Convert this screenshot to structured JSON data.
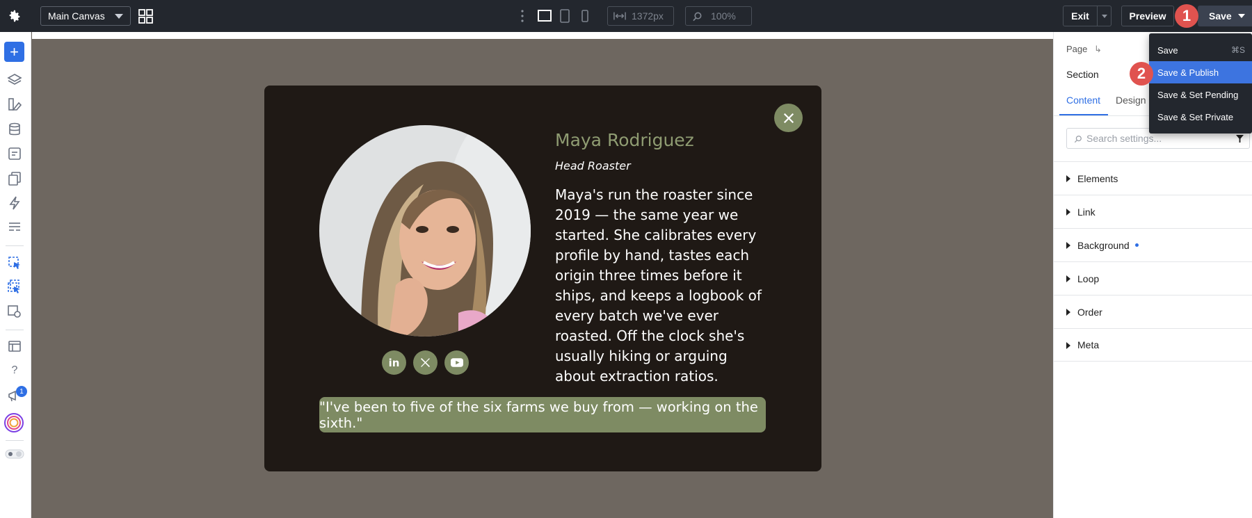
{
  "toolbar": {
    "canvas_select": "Main Canvas",
    "width_value": "1372px",
    "zoom_value": "100%",
    "exit_label": "Exit",
    "preview_label": "Preview",
    "save_label": "Save",
    "step1": "1",
    "step2": "2"
  },
  "save_menu": {
    "items": [
      {
        "label": "Save",
        "shortcut": "⌘S"
      },
      {
        "label": "Save & Publish",
        "shortcut": ""
      },
      {
        "label": "Save & Set Pending",
        "shortcut": ""
      },
      {
        "label": "Save & Set Private",
        "shortcut": ""
      }
    ],
    "highlighted_index": 1
  },
  "sidebar": {
    "notification_count": "1",
    "help_glyph": "?"
  },
  "profile": {
    "name": "Maya Rodriguez",
    "role": "Head Roaster",
    "bio": "Maya's run the roaster since 2019 — the same year we started. She calibrates every profile by hand, tastes each origin three times before it ships, and keeps a logbook of every batch we've ever roasted. Off the clock she's usually hiking or arguing about extraction ratios.",
    "quote": "\"I've been to five of the six farms we buy from — working on the sixth.\"",
    "social": [
      "linkedin-icon",
      "x-icon",
      "youtube-icon"
    ],
    "accent_color": "#7e8b63"
  },
  "panel": {
    "breadcrumb": "Page",
    "section_label": "Section",
    "tabs": [
      "Content",
      "Design"
    ],
    "search_placeholder": "Search settings...",
    "groups": [
      "Elements",
      "Link",
      "Background",
      "Loop",
      "Order",
      "Meta"
    ]
  }
}
